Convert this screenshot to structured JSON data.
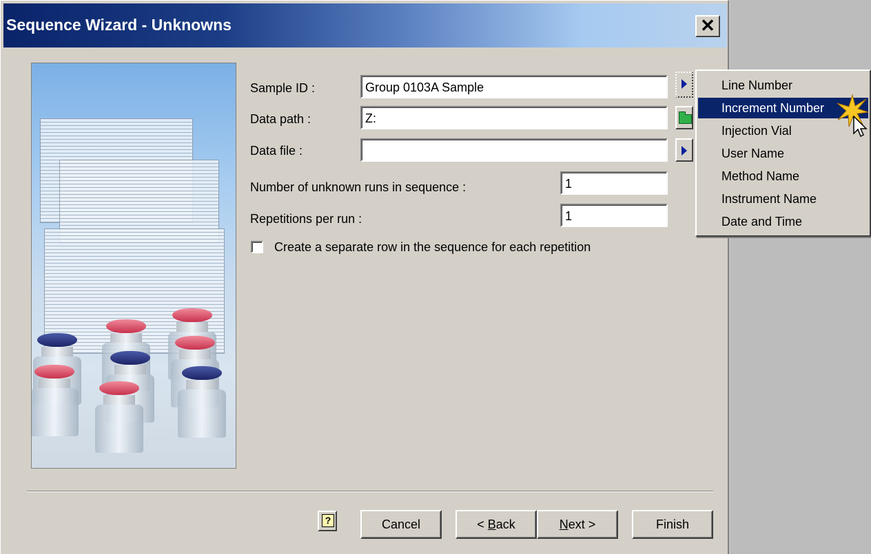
{
  "window": {
    "title": "Sequence Wizard - Unknowns",
    "close_label": "✕"
  },
  "form": {
    "sample_id": {
      "label": "Sample ID :",
      "value": "Group 0103A Sample"
    },
    "data_path": {
      "label": "Data path :",
      "value": "Z:"
    },
    "data_file": {
      "label": "Data file :",
      "value": ""
    },
    "num_runs": {
      "label": "Number of unknown runs in sequence :",
      "value": "1"
    },
    "repetitions": {
      "label": "Repetitions per run :",
      "value": "1"
    },
    "separate_row": {
      "label": "Create a separate row in the sequence for each repetition",
      "checked": false
    }
  },
  "buttons": {
    "help": "?",
    "cancel": "Cancel",
    "back_prefix": "< ",
    "back_key": "B",
    "back_rest": "ack",
    "next_key": "N",
    "next_rest": "ext >",
    "finish": "Finish"
  },
  "popup_menu": {
    "items": [
      {
        "label": "Line Number",
        "selected": false
      },
      {
        "label": "Increment Number",
        "selected": true
      },
      {
        "label": "Injection Vial",
        "selected": false
      },
      {
        "label": "User Name",
        "selected": false
      },
      {
        "label": "Method Name",
        "selected": false
      },
      {
        "label": "Instrument Name",
        "selected": false
      },
      {
        "label": "Date and Time",
        "selected": false
      }
    ]
  },
  "icons": {
    "close": "close-icon",
    "arrow": "arrow-right-icon",
    "folder": "folder-open-icon",
    "help": "help-icon",
    "cursor": "mouse-pointer-icon"
  },
  "colors": {
    "title_start": "#0a246a",
    "title_end": "#a6caf0",
    "selection": "#0a246a",
    "dialog_bg": "#d4d0c8"
  }
}
